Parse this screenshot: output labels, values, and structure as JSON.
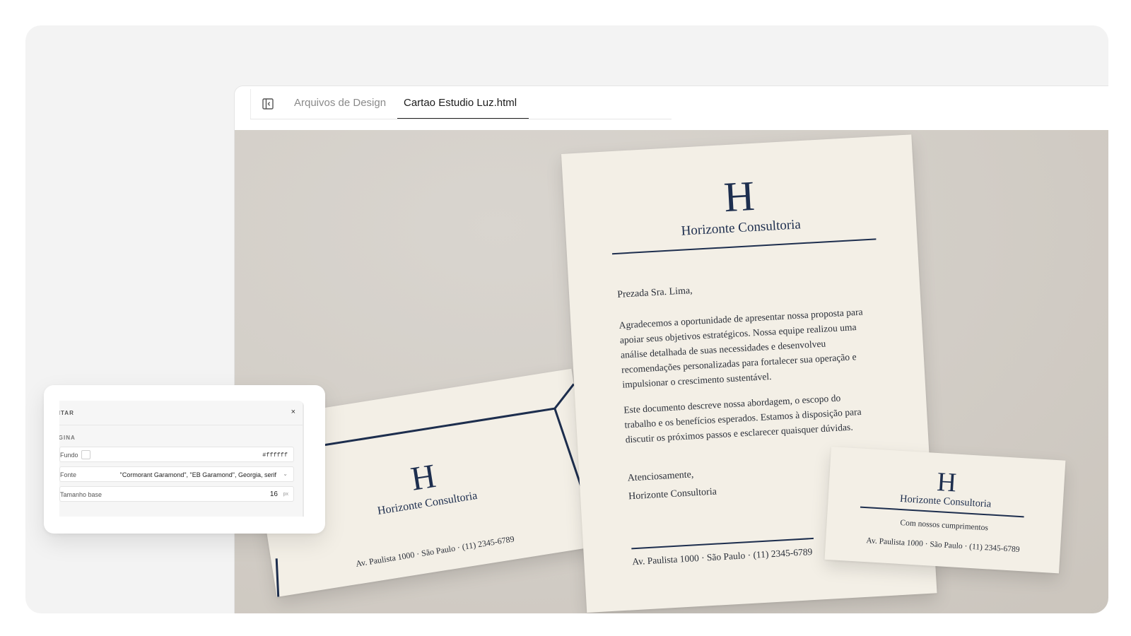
{
  "tabs": {
    "files_label": "Arquivos de Design",
    "active_label": "Cartao Estudio Luz.html"
  },
  "icons": {
    "sidebar_toggle": "sidebar-toggle-icon",
    "close": "close-icon",
    "dropdown": "chevron-down-icon"
  },
  "stationery": {
    "monogram": "H",
    "brand": "Horizonte Consultoria",
    "address": "Av. Paulista 1000 · São Paulo · (11) 2345-6789",
    "letter": {
      "greeting": "Prezada Sra. Lima,",
      "paragraph1": "Agradecemos a oportunidade de apresentar nossa proposta para apoiar seus objetivos estratégicos. Nossa equipe realizou uma análise detalhada de suas necessidades e desenvolveu recomendações personalizadas para fortalecer sua operação e impulsionar o crescimento sustentável.",
      "paragraph2": "Este documento descreve nossa abordagem, o escopo do trabalho e os benefícios esperados. Estamos à disposição para discutir os próximos passos e esclarecer quaisquer dúvidas.",
      "closing": "Atenciosamente,",
      "signature": "Horizonte Consultoria"
    },
    "card": {
      "tagline": "Com nossos cumprimentos"
    }
  },
  "editor": {
    "header": "DITAR",
    "close_glyph": "×",
    "section": "ÁGINA",
    "background": {
      "label": "Fundo",
      "value": "#ffffff"
    },
    "font": {
      "label": "Fonte",
      "value": "\"Cormorant Garamond\", \"EB Garamond\", Georgia, serif",
      "caret": "⌄"
    },
    "base_size": {
      "label": "Tamanho base",
      "value": "16",
      "unit": "px"
    }
  },
  "colors": {
    "ink_navy": "#1d2e4e",
    "paper": "#f3efe6",
    "surface": "#d2cdc6"
  }
}
